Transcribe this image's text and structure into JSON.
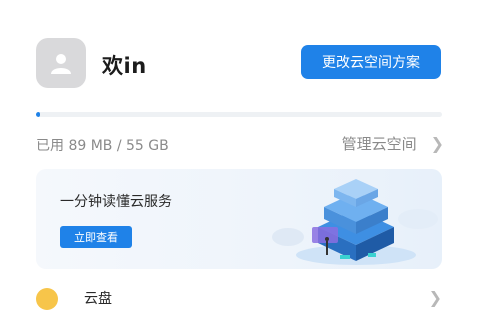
{
  "user": {
    "name": "欢in"
  },
  "header": {
    "change_plan_label": "更改云空间方案"
  },
  "storage": {
    "used_label": "已用 89 MB / 55 GB",
    "used_fraction": 0.0016,
    "manage_label": "管理云空间"
  },
  "banner": {
    "title": "一分钟读懂云服务",
    "button_label": "立即查看"
  },
  "list": {
    "first_item_label": "云盘"
  },
  "colors": {
    "accent": "#1f82e8",
    "muted_text": "#8a8a8a"
  },
  "icons": {
    "avatar": "default-user-avatar-icon",
    "chevron": "chevron-right-icon",
    "banner_illustration": "cloud-server-illustration-icon"
  }
}
